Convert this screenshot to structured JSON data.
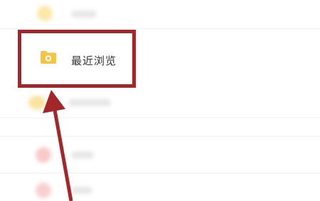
{
  "menu": {
    "recent_browsing_label": "最近浏览"
  },
  "colors": {
    "highlight_border": "#a3262b",
    "folder": "#f4c542",
    "arrow": "#a3262b"
  }
}
